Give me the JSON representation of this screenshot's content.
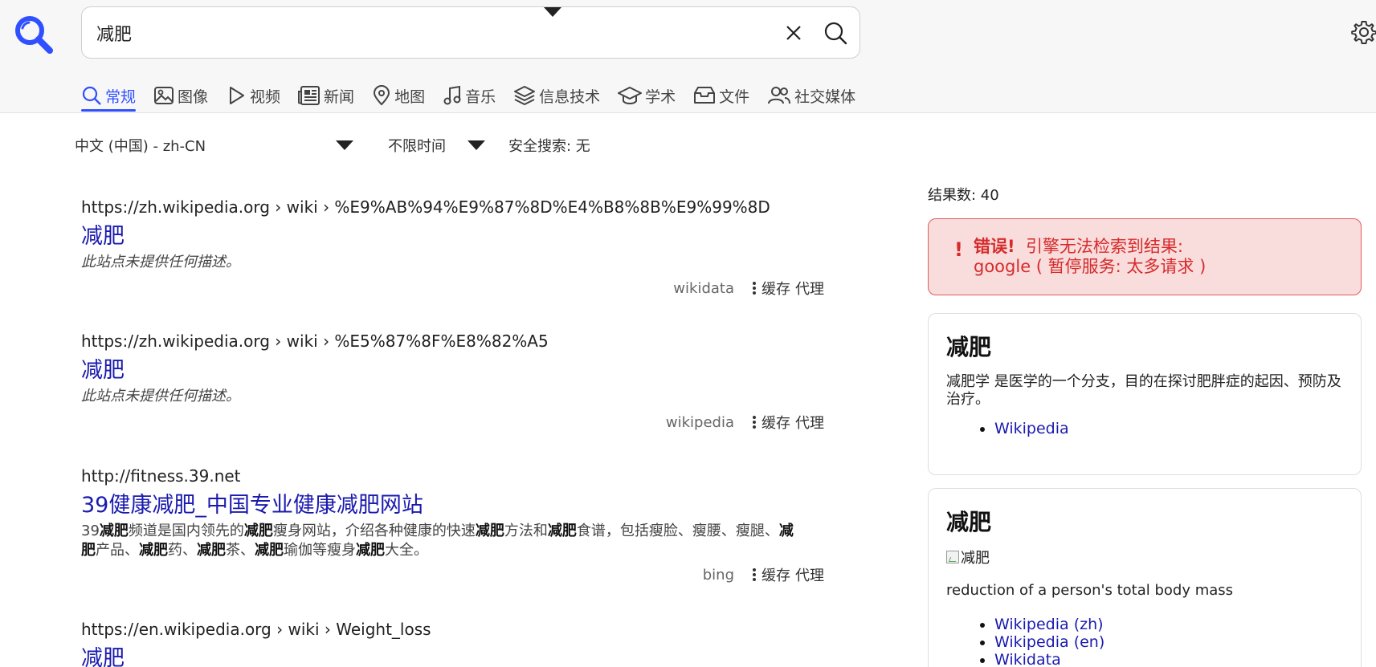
{
  "search": {
    "query": "减肥"
  },
  "tabs": [
    {
      "label": "常规",
      "icon": "search-icon",
      "active": true
    },
    {
      "label": "图像",
      "icon": "image-icon"
    },
    {
      "label": "视频",
      "icon": "play-icon"
    },
    {
      "label": "新闻",
      "icon": "newspaper-icon"
    },
    {
      "label": "地图",
      "icon": "map-pin-icon"
    },
    {
      "label": "音乐",
      "icon": "music-note-icon"
    },
    {
      "label": "信息技术",
      "icon": "layers-icon"
    },
    {
      "label": "学术",
      "icon": "graduation-cap-icon"
    },
    {
      "label": "文件",
      "icon": "archive-icon"
    },
    {
      "label": "社交媒体",
      "icon": "people-icon"
    }
  ],
  "filters": {
    "language": "中文 (中国) - zh-CN",
    "time": "不限时间",
    "safe": "安全搜索: 无"
  },
  "results": [
    {
      "url": "https://zh.wikipedia.org › wiki › %E9%AB%94%E9%87%8D%E4%B8%8B%E9%99%8D",
      "title": "减肥",
      "desc": "此站点未提供任何描述。",
      "engine": "wikidata",
      "cache": "缓存",
      "proxy": "代理"
    },
    {
      "url": "https://zh.wikipedia.org › wiki › %E5%87%8F%E8%82%A5",
      "title": "减肥",
      "desc": "此站点未提供任何描述。",
      "engine": "wikipedia",
      "cache": "缓存",
      "proxy": "代理"
    },
    {
      "url": "http://fitness.39.net",
      "title": "39健康减肥_中国专业健康减肥网站",
      "desc_parts": [
        "39",
        "减肥",
        "频道是国内领先的",
        "减肥",
        "瘦身网站，介绍各种健康的快速",
        "减肥",
        "方法和",
        "减肥",
        "食谱，包括瘦脸、瘦腰、瘦腿、",
        "减肥",
        "产品、",
        "减肥",
        "药、",
        "减肥",
        "茶、",
        "减肥",
        "瑜伽等瘦身",
        "减肥",
        "大全。"
      ],
      "engine": "bing",
      "cache": "缓存",
      "proxy": "代理"
    },
    {
      "url": "https://en.wikipedia.org › wiki › Weight_loss",
      "title": "减肥"
    }
  ],
  "sidebar": {
    "count": "结果数: 40",
    "error": {
      "mark": "!",
      "label": "错误!",
      "message": "引擎无法检索到结果:",
      "detail": "google ( 暂停服务: 太多请求 )"
    },
    "infobox1": {
      "title": "减肥",
      "text": "减肥学 是医学的一个分支，目的在探讨肥胖症的起因、预防及治疗。",
      "links": [
        "Wikipedia"
      ]
    },
    "infobox2": {
      "title": "减肥",
      "img_alt": "减肥",
      "text": "reduction of a person's total body mass",
      "links": [
        "Wikipedia (zh)",
        "Wikipedia (en)",
        "Wikidata"
      ]
    }
  },
  "colors": {
    "accent": "#3050ff",
    "link": "#1a1ab0",
    "error": "#d62b2b"
  }
}
